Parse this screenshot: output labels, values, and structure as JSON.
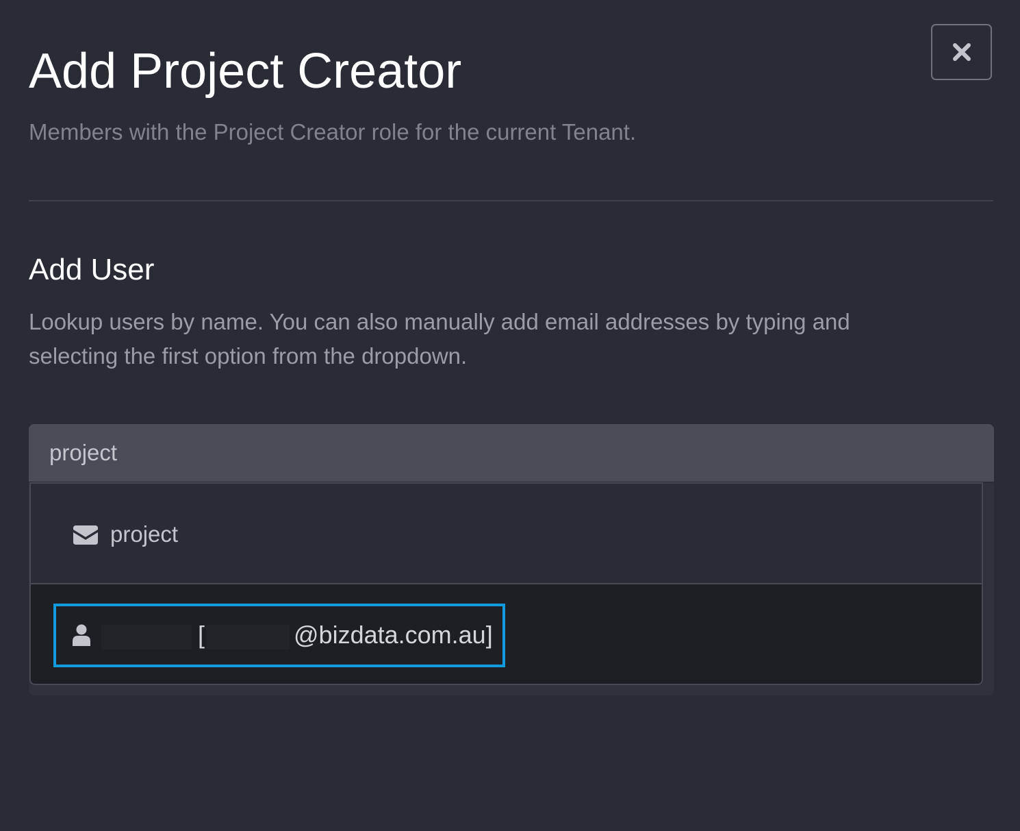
{
  "modal": {
    "title": "Add Project Creator",
    "subtitle": "Members with the Project Creator role for the current Tenant."
  },
  "add_user": {
    "heading": "Add User",
    "help_text": "Lookup users by name. You can also manually add email addresses by typing and selecting the first option from the dropdown."
  },
  "search": {
    "value": "project"
  },
  "dropdown": {
    "email_option": {
      "icon": "envelope-icon",
      "label": "project"
    },
    "user_option": {
      "icon": "user-icon",
      "bracket_open": "[",
      "email_suffix": "@bizdata.com.au]"
    }
  },
  "colors": {
    "background": "#2a2c35",
    "input_bg": "#4a4d57",
    "selected_row_bg": "#1e1f25",
    "highlight": "#119bdc"
  }
}
